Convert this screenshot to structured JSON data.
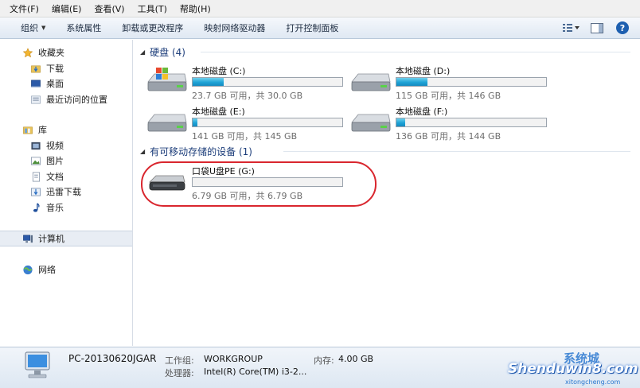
{
  "menu": [
    "文件(F)",
    "编辑(E)",
    "查看(V)",
    "工具(T)",
    "帮助(H)"
  ],
  "toolbar": {
    "organize": "组织",
    "system_properties": "系统属性",
    "uninstall": "卸载或更改程序",
    "map_drive": "映射网络驱动器",
    "control_panel": "打开控制面板"
  },
  "nav": {
    "favorites": "收藏夹",
    "downloads": "下载",
    "desktop": "桌面",
    "recent": "最近访问的位置",
    "libraries": "库",
    "videos": "视频",
    "pictures": "图片",
    "documents": "文档",
    "xunlei": "迅雷下载",
    "music": "音乐",
    "computer": "计算机",
    "network": "网络"
  },
  "groups": {
    "hdd": "硬盘 (4)",
    "removable": "有可移动存储的设备 (1)"
  },
  "drives": [
    {
      "name": "本地磁盘 (C:)",
      "info": "23.7 GB 可用，共 30.0 GB",
      "used": 0.21
    },
    {
      "name": "本地磁盘 (D:)",
      "info": "115 GB 可用，共 146 GB",
      "used": 0.21
    },
    {
      "name": "本地磁盘 (E:)",
      "info": "141 GB 可用，共 145 GB",
      "used": 0.03
    },
    {
      "name": "本地磁盘 (F:)",
      "info": "136 GB 可用，共 144 GB",
      "used": 0.06
    },
    {
      "name": "口袋U盘PE (G:)",
      "info": "6.79 GB 可用，共 6.79 GB",
      "used": 0.0
    }
  ],
  "details": {
    "pc_name": "PC-20130620JGAR",
    "workgroup_label": "工作组:",
    "workgroup": "WORKGROUP",
    "memory_label": "内存:",
    "memory": "4.00 GB",
    "cpu_label": "处理器:",
    "cpu": "Intel(R) Core(TM) i3-2..."
  },
  "watermark": {
    "text": "Shenduwin8.com",
    "cn": "系统城",
    "url": "xitongcheng.com"
  },
  "colors": {
    "accent": "#1ea3d6",
    "highlight": "#d9262e",
    "group_text": "#1c3d7a"
  }
}
